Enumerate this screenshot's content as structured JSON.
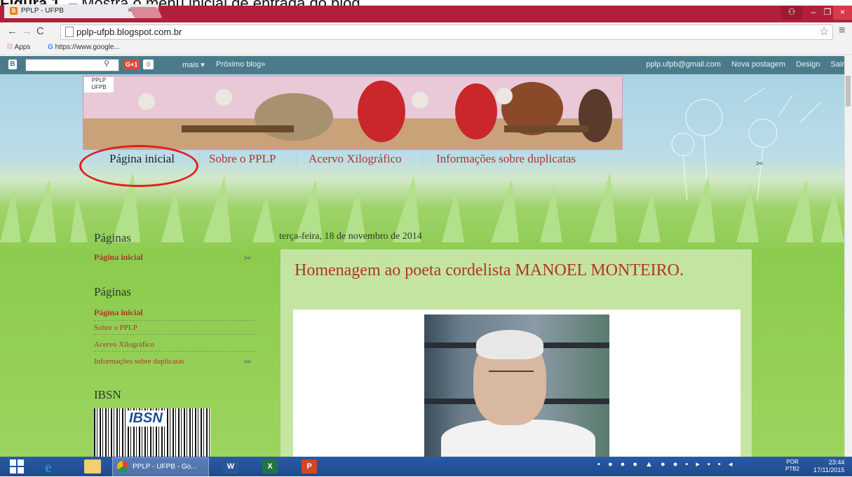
{
  "caption": {
    "prefix": "Figura 1.",
    "text": "– Mostra o menu inicial de entrada do blog"
  },
  "browser": {
    "tab_title": "PPLP - UFPB",
    "tab_close": "×",
    "url": "pplp-ufpb.blogspot.com.br",
    "bookmarks": {
      "apps": "Apps",
      "google": "https://www.google..."
    }
  },
  "blogger_navbar": {
    "gplus": "G+1",
    "gplus_count": "0",
    "more": "mais ▾",
    "next_blog": "Próximo blog»",
    "email": "pplp.ufpb@gmail.com",
    "new_post": "Nova postagem",
    "design": "Design",
    "sign_out": "Sair"
  },
  "banner": {
    "logo_text": "PPLP UFPB"
  },
  "nav": {
    "tabs": [
      {
        "label": "Página inicial"
      },
      {
        "label": "Sobre o PPLP"
      },
      {
        "label": "Acervo Xilográfico"
      },
      {
        "label": "Informações sobre duplicatas"
      }
    ]
  },
  "sidebar": {
    "section1_title": "Páginas",
    "section1_link": "Página inicial",
    "section2_title": "Páginas",
    "section2_links": [
      {
        "label": "Página inicial"
      },
      {
        "label": "Sobre o PPLP"
      },
      {
        "label": "Acervo Xilográfico"
      },
      {
        "label": "Informações sobre duplicatas"
      }
    ],
    "section3_title": "IBSN",
    "ibsn_logo": "IBSN"
  },
  "post": {
    "date": "terça-feira, 18 de novembro de 2014",
    "title": "Homenagem ao poeta cordelista MANOEL MONTEIRO."
  },
  "taskbar": {
    "chrome_label": "PPLP - UFPB - Go...",
    "lang_top": "POR",
    "lang_bottom": "PTB2",
    "time": "23:44",
    "date": "17/11/2015"
  },
  "colors": {
    "accent_link": "#b0352a",
    "navbar": "#4b7b8a",
    "taskbar": "#1f4a8c",
    "highlight_circle": "#e0201c"
  }
}
